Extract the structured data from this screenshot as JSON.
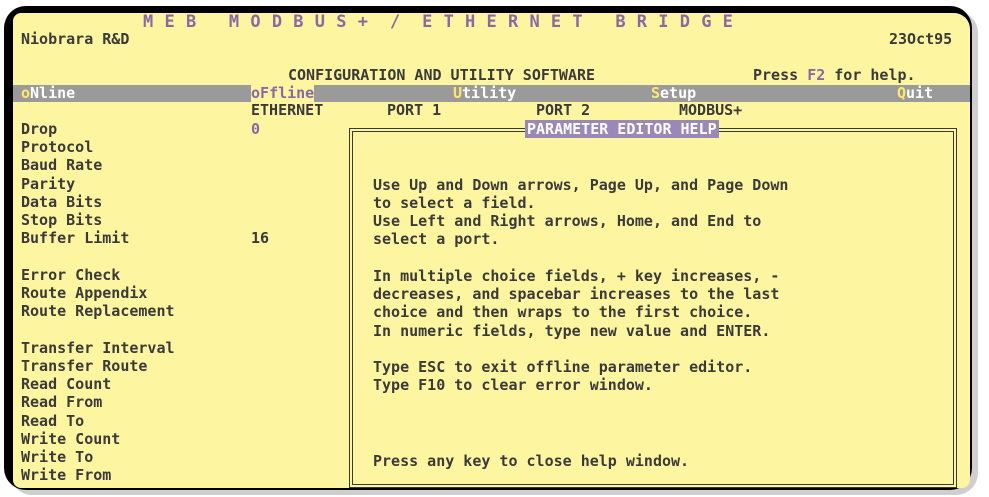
{
  "header": {
    "title": "M E B   M O D B U S +  /  E T H E R N E T   B R I D G E",
    "company": "Niobrara R&D",
    "date": "23Oct95",
    "subtitle": "CONFIGURATION AND UTILITY SOFTWARE",
    "help_prefix": "Press ",
    "help_key": "F2",
    "help_suffix": " for help."
  },
  "menu": {
    "online_hot": "o",
    "online_rest": "Nline",
    "offline_hot": "o",
    "offline_hot_F": "F",
    "offline_rest": "fline",
    "utility_hot": "U",
    "utility_rest": "tility",
    "setup_hot": "S",
    "setup_rest": "etup",
    "quit_hot": "Q",
    "quit_rest": "uit"
  },
  "columns": {
    "ethernet": "ETHERNET",
    "port1": "PORT 1",
    "port2": "PORT 2",
    "modbus": "MODBUS+"
  },
  "fields": [
    {
      "label": "Drop",
      "value": "0"
    },
    {
      "label": "Protocol",
      "value": ""
    },
    {
      "label": "Baud Rate",
      "value": ""
    },
    {
      "label": "Parity",
      "value": ""
    },
    {
      "label": "Data Bits",
      "value": ""
    },
    {
      "label": "Stop Bits",
      "value": ""
    },
    {
      "label": "Buffer Limit",
      "value": "16"
    },
    {
      "label": "Error Check",
      "value": ""
    },
    {
      "label": "Route Appendix",
      "value": ""
    },
    {
      "label": "Route Replacement",
      "value": ""
    },
    {
      "label": "Transfer Interval",
      "value": ""
    },
    {
      "label": "Transfer Route",
      "value": ""
    },
    {
      "label": "Read Count",
      "value": ""
    },
    {
      "label": "Read From",
      "value": ""
    },
    {
      "label": "Read To",
      "value": ""
    },
    {
      "label": "Write Count",
      "value": ""
    },
    {
      "label": "Write To",
      "value": ""
    },
    {
      "label": "Write From",
      "value": ""
    }
  ],
  "help": {
    "title": "PARAMETER EDITOR HELP",
    "lines": [
      "Use Up and Down arrows, Page Up, and Page Down",
      "to select a field.",
      "Use Left and Right arrows, Home, and End to",
      "select a port.",
      "In multiple choice fields, + key increases, -",
      "decreases, and spacebar increases to the last",
      "choice and then wraps to the first choice.",
      "In numeric fields, type new value and ENTER.",
      "Type ESC to exit offline parameter editor.",
      "Type F10 to clear error window."
    ],
    "footer": "Press any key to close help window."
  },
  "colors": {
    "background": "#fdf5a0",
    "text": "#3a3a3a",
    "accent_purple": "#8a68a8",
    "menubar": "#9a9a9a"
  }
}
